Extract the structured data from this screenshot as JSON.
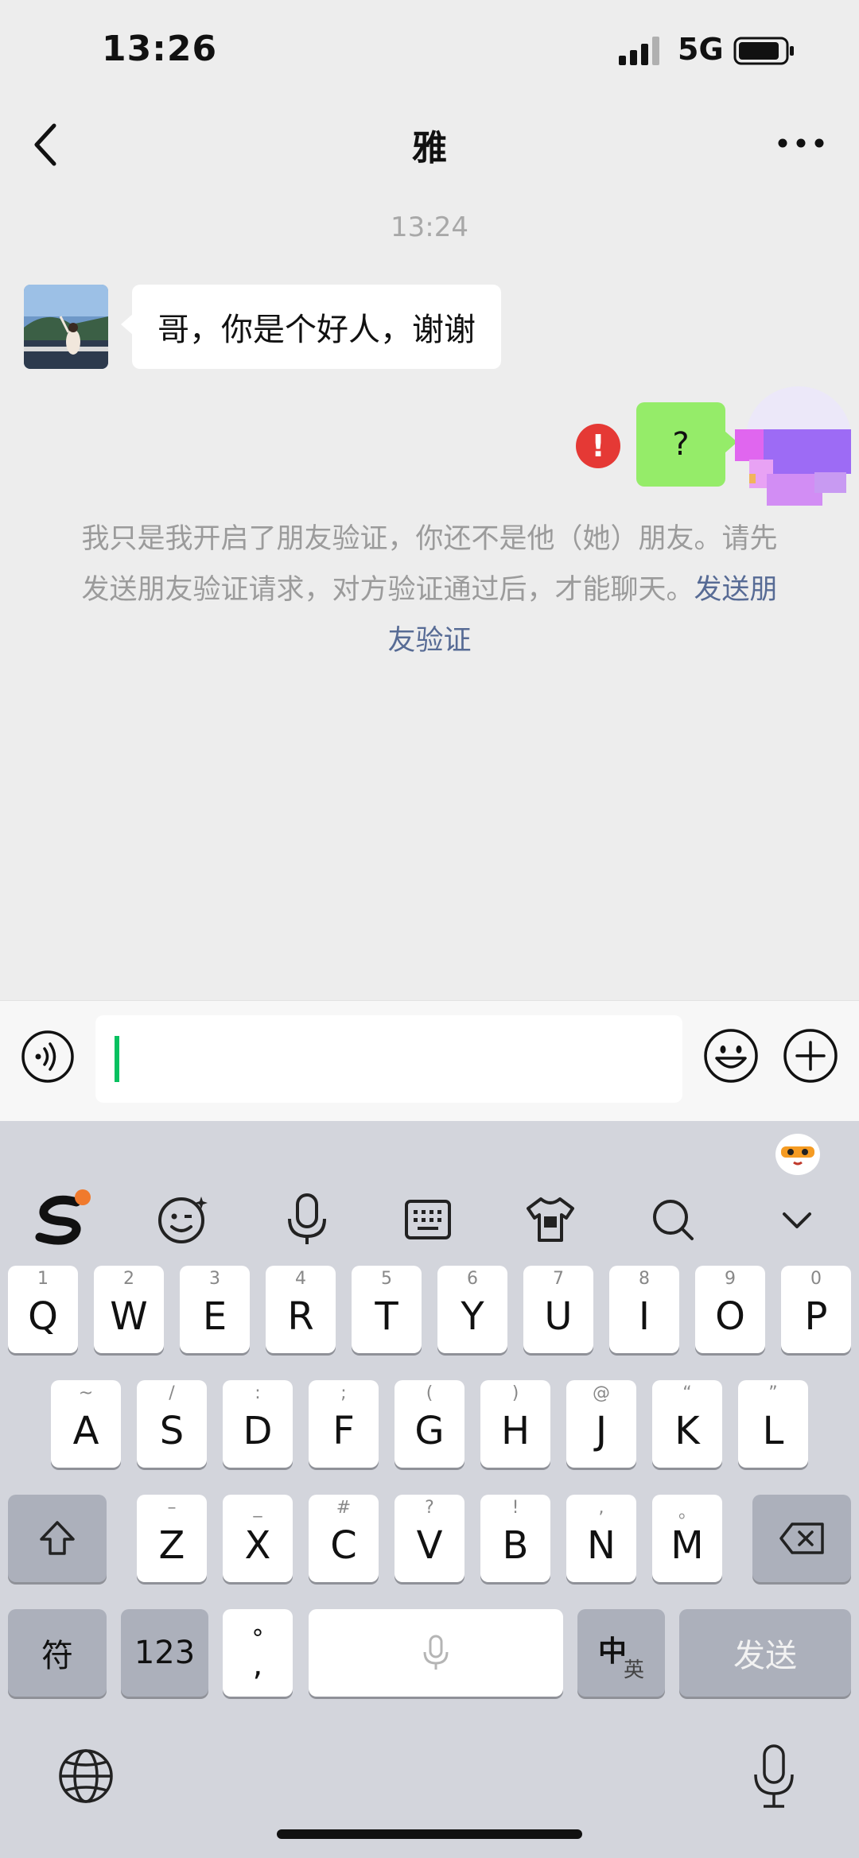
{
  "status_bar": {
    "time": "13:26",
    "network": "5G"
  },
  "nav": {
    "title": "雅"
  },
  "chat": {
    "timestamp": "13:24",
    "incoming_message": "哥，你是个好人，谢谢",
    "outgoing_message": "?",
    "error_badge": "!",
    "system_note_text": "我只是我开启了朋友验证，你还不是他（她）朋友。请先发送朋友验证请求，对方验证通过后，才能聊天。",
    "system_note_link": "发送朋友验证"
  },
  "input": {
    "value": "",
    "placeholder": ""
  },
  "keyboard": {
    "row1": [
      {
        "letter": "Q",
        "hint": "1"
      },
      {
        "letter": "W",
        "hint": "2"
      },
      {
        "letter": "E",
        "hint": "3"
      },
      {
        "letter": "R",
        "hint": "4"
      },
      {
        "letter": "T",
        "hint": "5"
      },
      {
        "letter": "Y",
        "hint": "6"
      },
      {
        "letter": "U",
        "hint": "7"
      },
      {
        "letter": "I",
        "hint": "8"
      },
      {
        "letter": "O",
        "hint": "9"
      },
      {
        "letter": "P",
        "hint": "0"
      }
    ],
    "row2": [
      {
        "letter": "A",
        "hint": "~"
      },
      {
        "letter": "S",
        "hint": "/"
      },
      {
        "letter": "D",
        "hint": ":"
      },
      {
        "letter": "F",
        "hint": ";"
      },
      {
        "letter": "G",
        "hint": "("
      },
      {
        "letter": "H",
        "hint": ")"
      },
      {
        "letter": "J",
        "hint": "@"
      },
      {
        "letter": "K",
        "hint": "“"
      },
      {
        "letter": "L",
        "hint": "”"
      }
    ],
    "row3": [
      {
        "letter": "Z",
        "hint": "–"
      },
      {
        "letter": "X",
        "hint": "_"
      },
      {
        "letter": "C",
        "hint": "#"
      },
      {
        "letter": "V",
        "hint": "?"
      },
      {
        "letter": "B",
        "hint": "!"
      },
      {
        "letter": "N",
        "hint": ","
      },
      {
        "letter": "M",
        "hint": "。"
      }
    ],
    "symbols_label": "符",
    "numbers_label": "123",
    "punct_top": "°",
    "punct_bottom": ",",
    "lang_main": "中",
    "lang_sub": "英",
    "send_label": "发送"
  }
}
